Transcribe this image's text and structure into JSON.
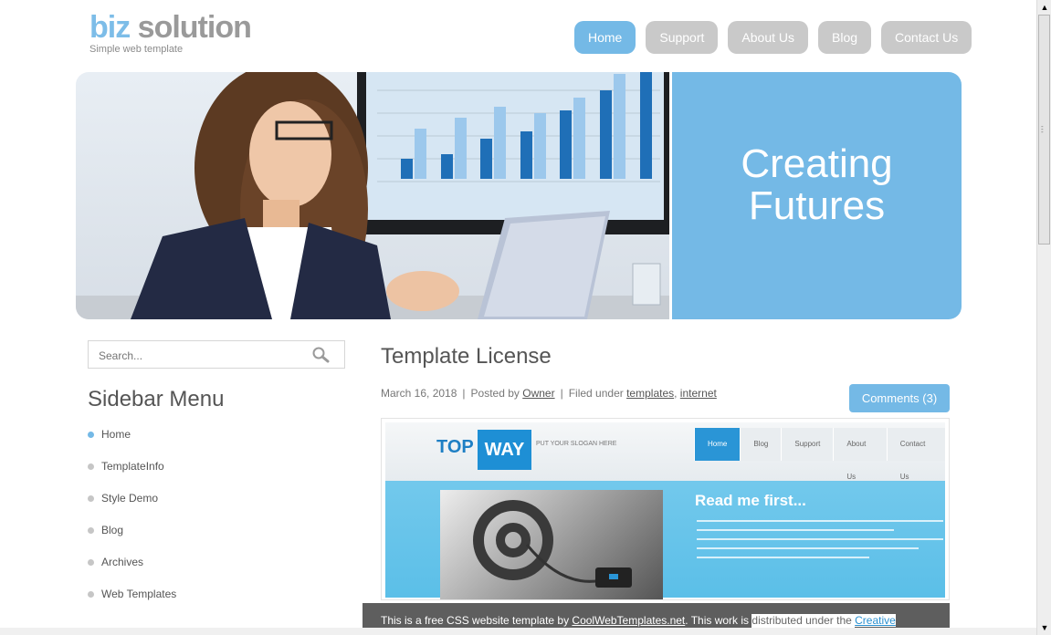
{
  "header": {
    "logo_part1": "biz",
    "logo_part2": " solution",
    "tagline": "Simple web template"
  },
  "nav": {
    "items": [
      {
        "label": "Home",
        "active": true
      },
      {
        "label": "Support"
      },
      {
        "label": "About Us"
      },
      {
        "label": "Blog"
      },
      {
        "label": "Contact Us"
      }
    ]
  },
  "banner": {
    "line1": "Creating",
    "line2": "Futures"
  },
  "sidebar": {
    "search_placeholder": "Search...",
    "title": "Sidebar Menu",
    "items": [
      {
        "label": "Home"
      },
      {
        "label": "TemplateInfo"
      },
      {
        "label": "Style Demo"
      },
      {
        "label": "Blog"
      },
      {
        "label": "Archives"
      },
      {
        "label": "Web Templates"
      }
    ]
  },
  "post": {
    "title": "Template License",
    "date": "March 16, 2018",
    "posted_by": "Posted by",
    "author": "Owner",
    "filed_under": "Filed under",
    "tag1": "templates",
    "tag2": "internet",
    "comments": "Comments (3)"
  },
  "preview": {
    "top": "TOP",
    "way": "WAY",
    "slogan": "PUT YOUR SLOGAN HERE",
    "nav": [
      "Home",
      "Blog",
      "Support",
      "About Us",
      "Contact Us"
    ],
    "read_more": "Read me first..."
  },
  "footer": {
    "part1": "This is a free CSS website template by ",
    "link": "CoolWebTemplates.net",
    "part2": ". This work is ",
    "part3": "distributed under the ",
    "link2": "Creative"
  },
  "colors": {
    "accent": "#74b9e6",
    "nav_inactive": "#c9c9c9"
  }
}
